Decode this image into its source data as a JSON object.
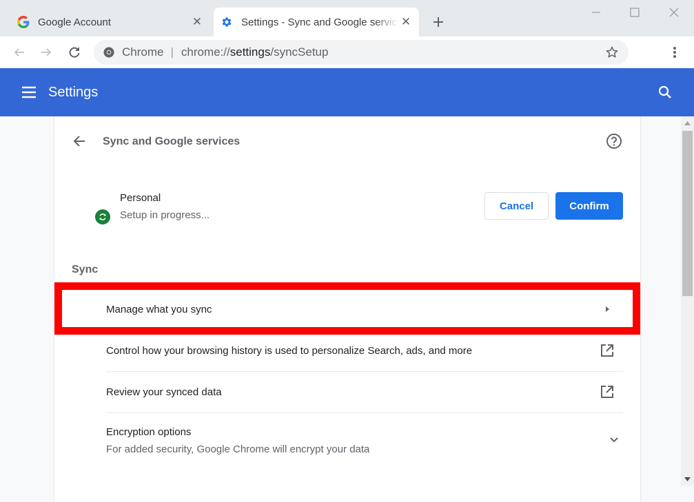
{
  "browser": {
    "tabs": [
      {
        "title": "Google Account",
        "favicon": "google-g-icon",
        "active": false
      },
      {
        "title": "Settings - Sync and Google services",
        "favicon": "gear-icon",
        "active": true
      }
    ],
    "new_tab_label": "+",
    "window_controls": [
      "minimize",
      "maximize",
      "close"
    ],
    "omnibox": {
      "site_chip": "Chrome",
      "separator": "|",
      "url_scheme": "chrome://",
      "url_host": "settings",
      "url_path": "/syncSetup"
    }
  },
  "settings_header": {
    "title": "Settings",
    "menu_icon": "hamburger-icon",
    "search_icon": "search-icon"
  },
  "page": {
    "title": "Sync and Google services",
    "back_icon": "arrow-back-icon",
    "help_icon": "help-circle-icon",
    "account": {
      "name": "Personal",
      "status": "Setup in progress...",
      "badge_icon": "sync-icon",
      "badge_color": "#188038"
    },
    "buttons": {
      "cancel": "Cancel",
      "confirm": "Confirm"
    },
    "sync_section": {
      "heading": "Sync",
      "items": [
        {
          "label": "Manage what you sync",
          "icon": "arrow-right-icon",
          "highlighted": true
        },
        {
          "label": "Control how your browsing history is used to personalize Search, ads, and more",
          "icon": "open-in-new-icon"
        },
        {
          "label": "Review your synced data",
          "icon": "open-in-new-icon"
        },
        {
          "label": "Encryption options",
          "sublabel": "For added security, Google Chrome will encrypt your data",
          "icon": "chevron-down-icon"
        }
      ]
    }
  },
  "colors": {
    "header_blue": "#3367d6",
    "primary_button": "#1a73e8",
    "highlight_red": "#ff0000"
  }
}
